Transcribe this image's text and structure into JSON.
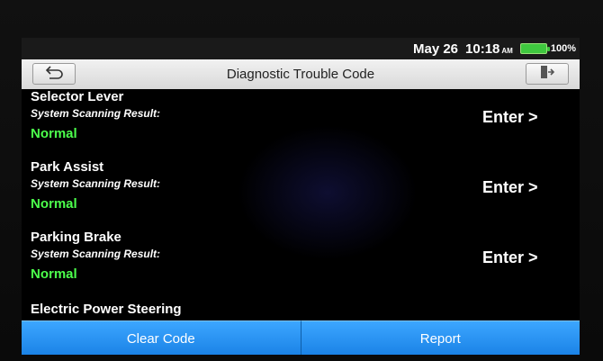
{
  "status_bar": {
    "date": "May 26",
    "time": "10:18",
    "ampm": "AM",
    "battery": "100%",
    "battery_level": 1.0
  },
  "header": {
    "title": "Diagnostic Trouble Code",
    "back_icon": "back-arrow-icon",
    "exit_icon": "exit-door-icon"
  },
  "systems": [
    {
      "name": "Selector Lever",
      "result_label": "System Scanning Result:",
      "result": "Normal",
      "enter_label": "Enter >"
    },
    {
      "name": "Park Assist",
      "result_label": "System Scanning Result:",
      "result": "Normal",
      "enter_label": "Enter >"
    },
    {
      "name": "Parking Brake",
      "result_label": "System Scanning Result:",
      "result": "Normal",
      "enter_label": "Enter >"
    }
  ],
  "partial_item": {
    "name": "Electric Power Steering"
  },
  "footer": {
    "clear_label": "Clear Code",
    "report_label": "Report"
  },
  "colors": {
    "accent_button": "#2a94f4",
    "normal_status": "#4cff4c",
    "battery": "#3fc83f"
  }
}
